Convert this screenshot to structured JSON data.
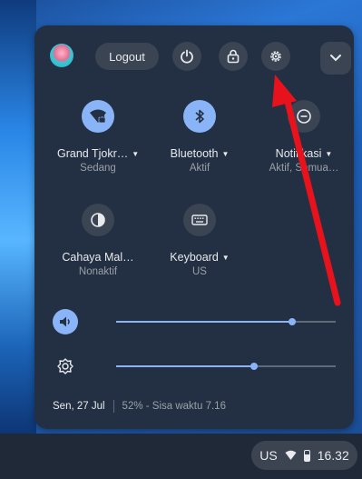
{
  "header": {
    "logout_label": "Logout",
    "avatar_icon": "user-avatar",
    "power_icon": "power-icon",
    "lock_icon": "lock-icon",
    "settings_icon": "gear-icon",
    "expand_icon": "chevron-down-icon"
  },
  "tiles": [
    {
      "label": "Grand Tjokr…",
      "sub": "Sedang",
      "icon": "wifi-locked-icon",
      "active": true
    },
    {
      "label": "Bluetooth",
      "sub": "Aktif",
      "icon": "bluetooth-icon",
      "active": true
    },
    {
      "label": "Notifikasi",
      "sub": "Aktif, Semua…",
      "icon": "do-not-disturb-icon",
      "active": false
    },
    {
      "label": "Cahaya Mal…",
      "sub": "Nonaktif",
      "icon": "night-light-icon",
      "active": false
    },
    {
      "label": "Keyboard",
      "sub": "US",
      "icon": "keyboard-icon",
      "active": false
    }
  ],
  "sliders": {
    "volume": {
      "icon": "volume-icon",
      "value_percent": 80
    },
    "brightness": {
      "icon": "brightness-icon",
      "value_percent": 63
    }
  },
  "footer": {
    "date": "Sen, 27 Jul",
    "battery": "52% - Sisa waktu 7.16"
  },
  "shelf": {
    "input_method": "US",
    "time": "16.32"
  },
  "colors": {
    "panel": "#233043",
    "accent": "#8ab4f8",
    "arrow": "#e8121c"
  }
}
